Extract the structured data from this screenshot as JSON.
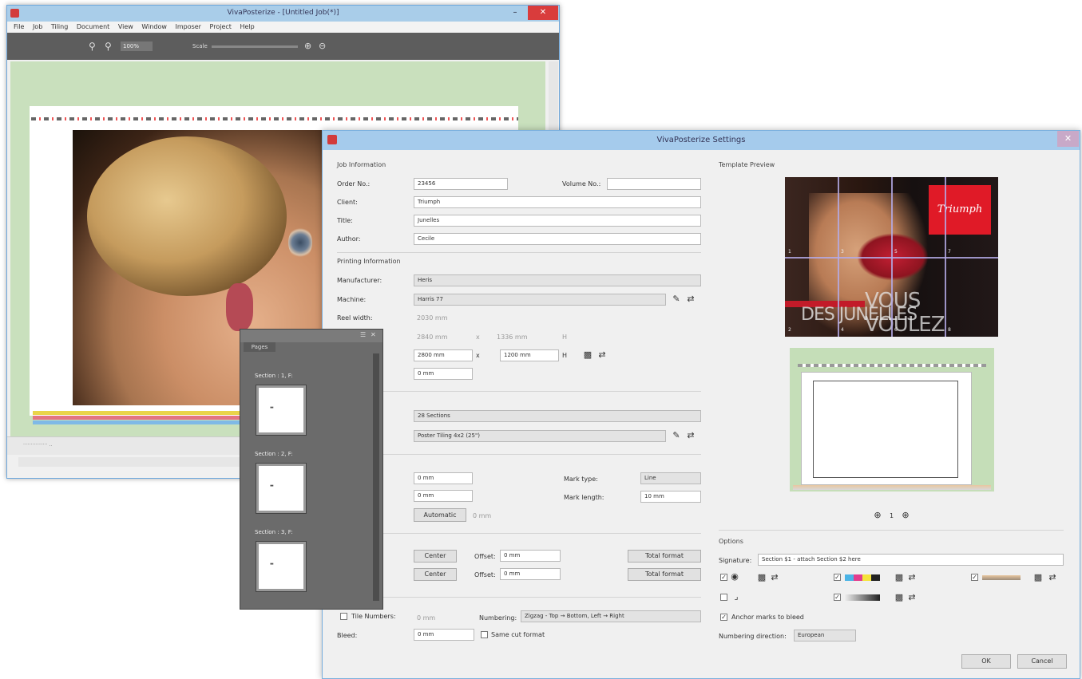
{
  "main_window": {
    "title": "VivaPosterize - [Untitled Job(*)]",
    "menu": [
      "File",
      "Job",
      "Tiling",
      "Document",
      "View",
      "Window",
      "Imposer",
      "Project",
      "Help"
    ],
    "toolbar": {
      "zoom": "100%",
      "slider_label": "Scale"
    },
    "status": "················ .."
  },
  "pages_panel": {
    "title": "Pages",
    "sections": [
      "Section : 1, F:",
      "Section : 2, F:",
      "Section : 3, F:"
    ]
  },
  "dialog": {
    "title": "VivaPosterize Settings",
    "job": {
      "group": "Job Information",
      "order_label": "Order No.:",
      "order_value": "23456",
      "volume_label": "Volume No.:",
      "volume_value": "",
      "client_label": "Client:",
      "client_value": "Triumph",
      "title_label": "Title:",
      "title_value": "Junelles",
      "author_label": "Author:",
      "author_value": "Cecile"
    },
    "printing": {
      "group": "Printing Information",
      "manufacturer_label": "Manufacturer:",
      "manufacturer_value": "Heris",
      "machine_label": "Machine:",
      "machine_value": "Harris 77",
      "reel_label": "Reel width:",
      "reel_value": "2030 mm",
      "size1_w": "2840 mm",
      "size1_h": "1336 mm",
      "size2_w": "2800 mm",
      "size2_h": "1200 mm",
      "offset_value": "0 mm",
      "h_letter": "H",
      "x_letter": "x"
    },
    "tiling": {
      "sections_value": "28 Sections",
      "template_value": "Poster Tiling 4x2 (25\")"
    },
    "marks": {
      "margin1": "0 mm",
      "margin2": "0 mm",
      "auto_label": "Automatic",
      "auto_value": "0 mm",
      "mark_type_label": "Mark type:",
      "mark_type_value": "Line",
      "mark_length_label": "Mark length:",
      "mark_length_value": "10 mm"
    },
    "alignment": {
      "h_align": "Center",
      "v_align": "Center",
      "offset_label": "Offset:",
      "offset1": "0 mm",
      "offset2": "0 mm",
      "total_format": "Total format"
    },
    "bottom": {
      "tile_numbers_label": "Tile Numbers:",
      "tile_numbers_value": "0 mm",
      "numbering_label": "Numbering:",
      "numbering_value": "Zigzag - Top → Bottom, Left → Right",
      "bleed_label": "Bleed:",
      "bleed_value": "0 mm",
      "same_cut_label": "Same cut format"
    },
    "preview": {
      "group": "Template Preview",
      "brand": "Triumph",
      "slogan1": "VOUS VOULEZ",
      "slogan2": "DES JUNELLES",
      "tile_numbers": [
        "1",
        "2",
        "3",
        "4",
        "5",
        "6",
        "7",
        "8"
      ],
      "zoom_label": "1"
    },
    "options": {
      "group": "Options",
      "signature_label": "Signature:",
      "signature_value": "Section $1 - attach Section $2 here",
      "anchor_label": "Anchor marks to bleed",
      "num_dir_label": "Numbering direction:",
      "num_dir_value": "European"
    },
    "ok_label": "OK",
    "cancel_label": "Cancel"
  }
}
